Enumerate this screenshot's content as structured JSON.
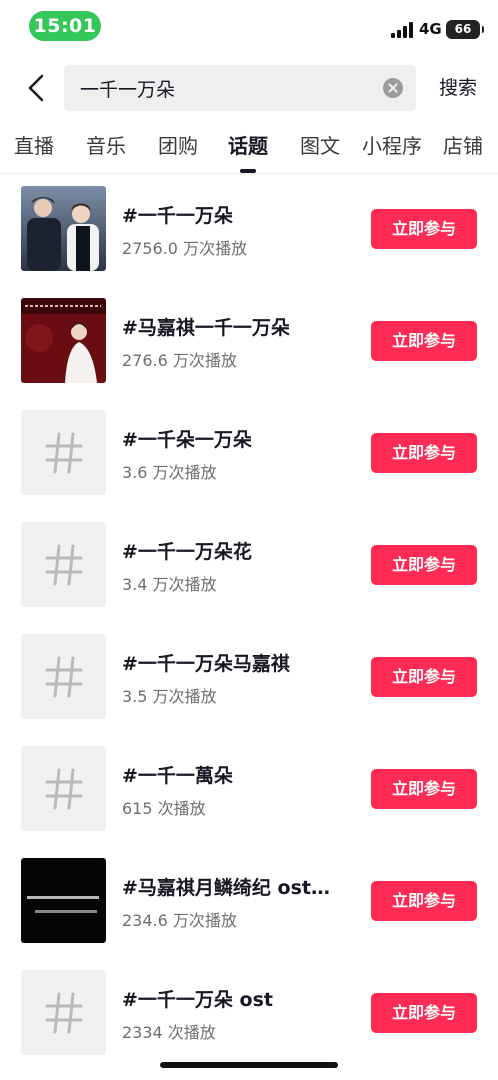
{
  "status_bar": {
    "time": "15:01",
    "network": "4G",
    "battery": "66"
  },
  "search": {
    "query": "一千一万朵",
    "button_label": "搜索"
  },
  "tabs": [
    {
      "label": "直播",
      "active": false
    },
    {
      "label": "音乐",
      "active": false
    },
    {
      "label": "团购",
      "active": false
    },
    {
      "label": "话题",
      "active": true
    },
    {
      "label": "图文",
      "active": false
    },
    {
      "label": "小程序",
      "active": false
    },
    {
      "label": "店铺",
      "active": false
    }
  ],
  "topics": [
    {
      "title": "#一千一万朵",
      "plays": "2756.0 万次播放",
      "button": "立即参与",
      "thumb": "photo-two-men-stage"
    },
    {
      "title": "#马嘉祺一千一万朵",
      "plays": "276.6 万次播放",
      "button": "立即参与",
      "thumb": "photo-singer-red-background"
    },
    {
      "title": "#一千朵一万朵",
      "plays": "3.6 万次播放",
      "button": "立即参与",
      "thumb": "hashtag-placeholder"
    },
    {
      "title": "#一千一万朵花",
      "plays": "3.4 万次播放",
      "button": "立即参与",
      "thumb": "hashtag-placeholder"
    },
    {
      "title": "#一千一万朵马嘉祺",
      "plays": "3.5 万次播放",
      "button": "立即参与",
      "thumb": "hashtag-placeholder"
    },
    {
      "title": "#一千一萬朵",
      "plays": "615 次播放",
      "button": "立即参与",
      "thumb": "hashtag-placeholder"
    },
    {
      "title": "#马嘉祺月鳞绮纪 ost…",
      "plays": "234.6 万次播放",
      "button": "立即参与",
      "thumb": "photo-dark-lyrics"
    },
    {
      "title": "#一千一万朵 ost",
      "plays": "2334 次播放",
      "button": "立即参与",
      "thumb": "hashtag-placeholder"
    }
  ],
  "colors": {
    "accent": "#fe2c55",
    "status_pill": "#34c759",
    "placeholder_bg": "#f1f1f1"
  }
}
